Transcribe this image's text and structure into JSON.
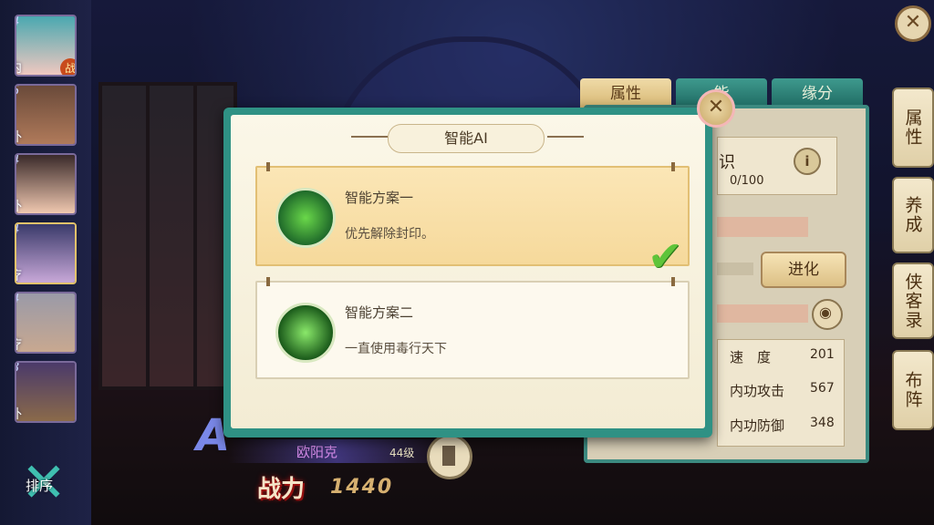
{
  "heroes": [
    {
      "role": "内",
      "num": "4",
      "fight": "战"
    },
    {
      "role": "外",
      "num": "5",
      "fight": ""
    },
    {
      "role": "外",
      "num": "4",
      "fight": ""
    },
    {
      "role": "疗",
      "num": "4",
      "fight": ""
    },
    {
      "role": "疗",
      "num": "4",
      "fight": ""
    },
    {
      "role": "外",
      "num": "3",
      "fight": ""
    }
  ],
  "sort_label": "排序",
  "hero_info": {
    "name": "欧阳克",
    "level": "44级",
    "power_label": "战力",
    "power_value": "1440"
  },
  "right_panel": {
    "tabs": [
      "属性",
      "能",
      "缘分"
    ],
    "knowledge_label": "识",
    "knowledge_value": "0/100",
    "evolve": "进化",
    "stats": [
      {
        "name": "速　度",
        "value": "201"
      },
      {
        "name": "内功攻击",
        "value": "567"
      },
      {
        "name": "内功防御",
        "value": "348"
      }
    ]
  },
  "side_menu": [
    "属性",
    "养成",
    "侠客录",
    "布阵"
  ],
  "dialog": {
    "title": "智能AI",
    "plans": [
      {
        "title": "智能方案一",
        "desc": "优先解除封印。",
        "selected": true
      },
      {
        "title": "智能方案二",
        "desc": "一直使用毒行天下",
        "selected": false
      }
    ]
  },
  "colors": {
    "accent": "#2f9184",
    "selected_plan": "#f6d99b",
    "check": "#5fc43a"
  }
}
